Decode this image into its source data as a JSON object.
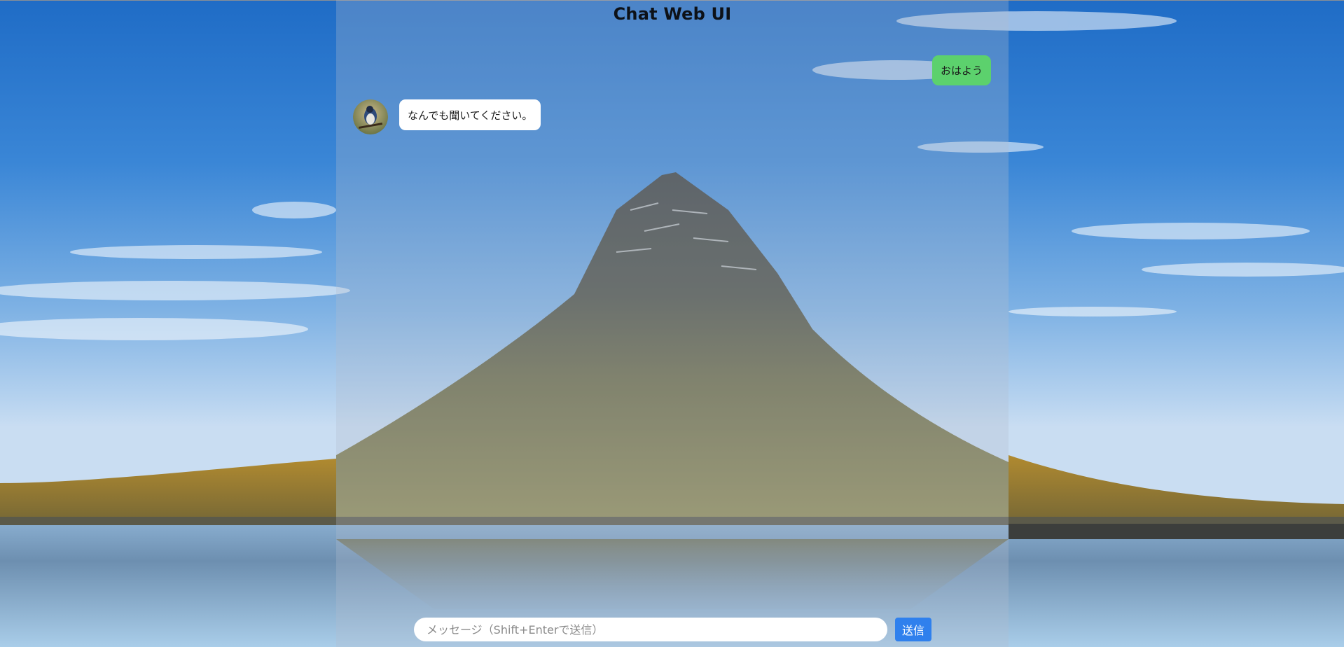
{
  "app": {
    "title": "Chat Web UI"
  },
  "messages": [
    {
      "role": "user",
      "text": "おはよう"
    },
    {
      "role": "assistant",
      "text": "なんでも聞いてください。",
      "avatar_icon": "bird-avatar-icon"
    }
  ],
  "composer": {
    "placeholder": "メッセージ（Shift+Enterで送信）",
    "value": "",
    "send_label": "送信"
  },
  "colors": {
    "user_bubble": "#5cd16d",
    "bot_bubble": "#ffffff",
    "send_button": "#2f80ed",
    "title": "#0d1117"
  }
}
